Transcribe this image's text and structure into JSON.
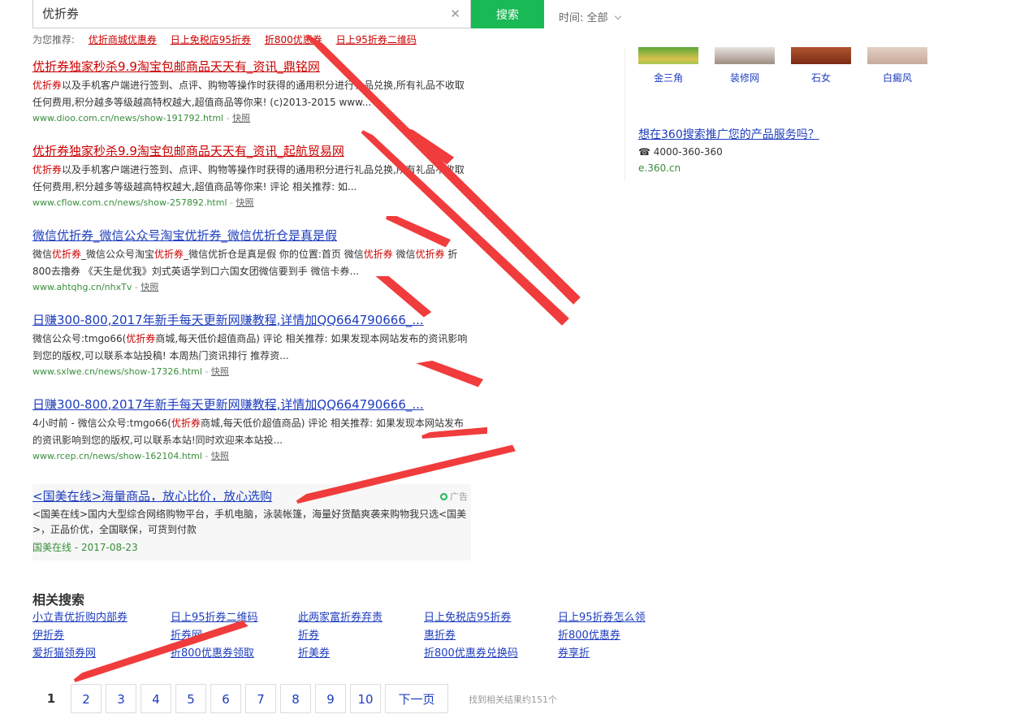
{
  "search": {
    "query": "优折券",
    "button": "搜索",
    "time_label": "时间:",
    "time_value": "全部"
  },
  "recommend": {
    "label": "为您推荐:",
    "items": [
      "优折商城优惠券",
      "日上免税店95折券",
      "折800优惠券",
      "日上95折券二维码"
    ]
  },
  "results": [
    {
      "title_hl": "优折券",
      "title_rest": "独家秒杀9.9淘宝包邮商品天天有_资讯_鼎铭网",
      "abs": [
        [
          "hl",
          "优折券"
        ],
        [
          "t",
          "以及手机客户端进行签到、点评、购物等操作时获得的通用积分进行礼品兑换,所有礼品不收取任何费用,积分越多等级越高特权越大,超值商品等你来! (c)2013-2015 www..."
        ]
      ],
      "url": "www.dioo.com.cn/news/show-191792.html",
      "snap": "快照"
    },
    {
      "title_hl": "优折券",
      "title_rest": "独家秒杀9.9淘宝包邮商品天天有_资讯_起航贸易网",
      "abs": [
        [
          "hl",
          "优折券"
        ],
        [
          "t",
          "以及手机客户端进行签到、点评、购物等操作时获得的通用积分进行礼品兑换,所有礼品不收取任何费用,积分越多等级越高特权越大,超值商品等你来! 评论 相关推荐: 如..."
        ]
      ],
      "url": "www.cflow.com.cn/news/show-257892.html",
      "snap": "快照"
    },
    {
      "title": "微信优折券_微信公众号淘宝优折券_微信优折仓是真是假",
      "abs": [
        [
          "t",
          "微信"
        ],
        [
          "hl",
          "优折券"
        ],
        [
          "t",
          "_微信公众号淘宝"
        ],
        [
          "hl",
          "优折券"
        ],
        [
          "t",
          "_微信优折仓是真是假 你的位置:首页 微信"
        ],
        [
          "hl",
          "优折券"
        ],
        [
          "t",
          " 微信"
        ],
        [
          "hl",
          "优折券"
        ],
        [
          "t",
          " 折800去撸券 《天生是优我》刘式英语学到口六国女团微信要到手 微信卡券..."
        ]
      ],
      "url": "www.ahtqhg.cn/nhxTv",
      "snap": "快照"
    },
    {
      "title": "日赚300-800,2017年新手每天更新网赚教程,详情加QQ664790666_...",
      "abs": [
        [
          "t",
          "微信公众号:tmgo66("
        ],
        [
          "hl",
          "优折券"
        ],
        [
          "t",
          "商城,每天低价超值商品) 评论 相关推荐: 如果发现本网站发布的资讯影响到您的版权,可以联系本站投稿! 本周热门资讯排行 推荐资..."
        ]
      ],
      "url": "www.sxlwe.cn/news/show-17326.html",
      "snap": "快照"
    },
    {
      "title": "日赚300-800,2017年新手每天更新网赚教程,详情加QQ664790666_...",
      "abs": [
        [
          "t",
          "4小时前 - 微信公众号:tmgo66("
        ],
        [
          "hl",
          "优折券"
        ],
        [
          "t",
          "商城,每天低价超值商品) 评论 相关推荐: 如果发现本网站发布的资讯影响到您的版权,可以联系本站!同时欢迎来本站投..."
        ]
      ],
      "url": "www.rcep.cn/news/show-162104.html",
      "snap": "快照"
    }
  ],
  "ad": {
    "title": "<国美在线>海量商品，放心比价，放心选购",
    "badge": "广告",
    "abs": "<国美在线>国内大型综合网络购物平台，手机电脑，泳装帐篷，海量好货酷爽袭来购物我只选<国美>，正品价优，全国联保，可货到付款",
    "meta": "国美在线 - 2017-08-23"
  },
  "related": {
    "title": "相关搜索",
    "items": [
      [
        "小立青优折购内部券",
        "日上95折券二维码",
        "此两家富折券弃责",
        "日上免税店95折券",
        "日上95折券怎么领"
      ],
      [
        "伊折券",
        "折券网",
        "折券",
        "惠折券",
        "折800优惠券"
      ],
      [
        "爱折猫领券网",
        "折800优惠券领取",
        "折美券",
        "折800优惠券兑换码",
        "券享折"
      ]
    ]
  },
  "pagination": {
    "pages": [
      "1",
      "2",
      "3",
      "4",
      "5",
      "6",
      "7",
      "8",
      "9",
      "10"
    ],
    "next": "下一页",
    "info": "找到相关结果约151个"
  },
  "sidebar": {
    "thumbs": [
      "金三角",
      "装修网",
      "石女",
      "白癜风"
    ],
    "promo": "想在360搜索推广您的产品服务吗？",
    "phone": "☎ 4000-360-360",
    "url": "e.360.cn"
  },
  "colors": {
    "accent": "#19b955",
    "link": "#1e3dbd",
    "highlight": "#cc0000",
    "arrow": "#f03c3c"
  }
}
